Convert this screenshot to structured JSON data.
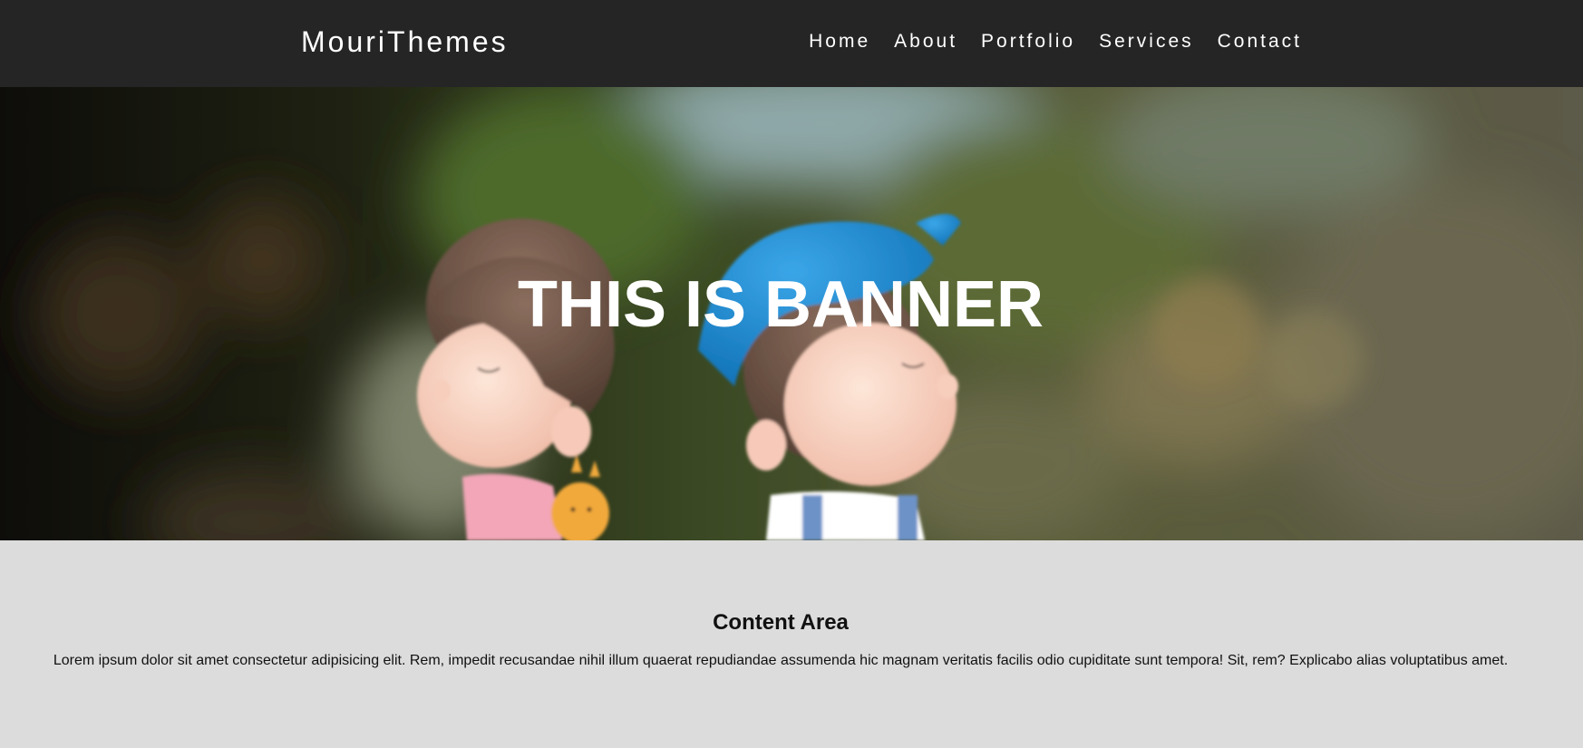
{
  "header": {
    "brand": "MouriThemes",
    "nav": [
      {
        "label": "Home"
      },
      {
        "label": "About"
      },
      {
        "label": "Portfolio"
      },
      {
        "label": "Services"
      },
      {
        "label": "Contact"
      }
    ]
  },
  "banner": {
    "title": "THIS IS BANNER",
    "image": "figurines-photo"
  },
  "content": {
    "title": "Content Area",
    "text": "Lorem ipsum dolor sit amet consectetur adipisicing elit. Rem, impedit recusandae nihil illum quaerat repudiandae assumenda hic magnam veritatis facilis odio cupiditate sunt tempora! Sit, rem? Explicabo alias voluptatibus amet."
  },
  "colors": {
    "navbar_bg": "#252525",
    "content_bg": "#dcdcdc",
    "text_light": "#ffffff",
    "text_dark": "#111111"
  }
}
